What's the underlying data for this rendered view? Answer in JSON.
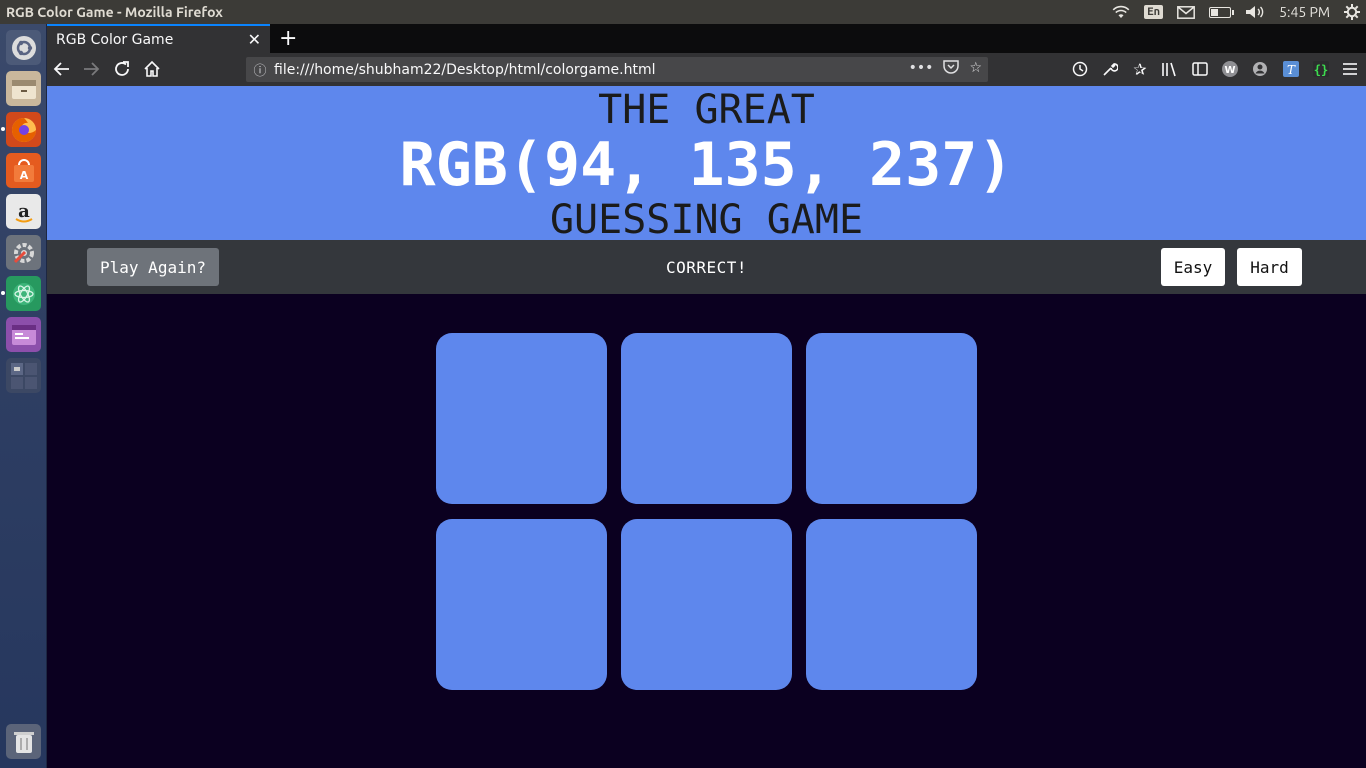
{
  "system_bar": {
    "window_title": "RGB Color Game - Mozilla Firefox",
    "lang": "En",
    "time": "5:45 PM",
    "icons": [
      "wifi-icon",
      "mail-icon",
      "battery-icon",
      "volume-icon",
      "settings-gear-icon"
    ]
  },
  "launcher": {
    "items": [
      {
        "name": "ubuntu-dash-icon",
        "color": "#e8e8e8"
      },
      {
        "name": "files-icon",
        "color": "#d9b38c"
      },
      {
        "name": "firefox-icon",
        "color": "#e66000"
      },
      {
        "name": "software-center-icon",
        "color": "#e95420"
      },
      {
        "name": "amazon-icon",
        "color": "#f0f0f0"
      },
      {
        "name": "system-settings-icon",
        "color": "#9aa0a6"
      },
      {
        "name": "atom-editor-icon",
        "color": "#2fa36b"
      },
      {
        "name": "window-manager-icon",
        "color": "#a15fbf"
      },
      {
        "name": "workspace-switcher-icon",
        "color": "#4a5570"
      },
      {
        "name": "trash-icon",
        "color": "#cfcfcf"
      }
    ]
  },
  "browser": {
    "tab_title": "RGB Color Game",
    "tab_close": "✕",
    "new_tab": "+",
    "url": "file:///home/shubham22/Desktop/html/colorgame.html",
    "url_actions": "•••"
  },
  "game": {
    "title_top": "THE GREAT",
    "color_display": "RGB(94, 135, 237)",
    "title_bottom": "GUESSING GAME",
    "reset_label": "Play Again?",
    "message": "CORRECT!",
    "easy_label": "Easy",
    "hard_label": "Hard",
    "header_color": "#5e87ed",
    "square_colors": [
      "#5e87ed",
      "#5e87ed",
      "#5e87ed",
      "#5e87ed",
      "#5e87ed",
      "#5e87ed"
    ],
    "background_color": "#0b0020"
  }
}
